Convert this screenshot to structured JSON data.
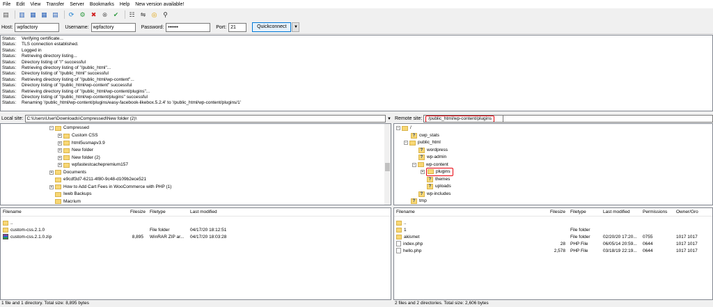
{
  "menu": [
    "File",
    "Edit",
    "View",
    "Transfer",
    "Server",
    "Bookmarks",
    "Help",
    "New version available!"
  ],
  "toolbar_icons": [
    "site-manager-icon",
    "toggle-log-icon",
    "toggle-local-tree-icon",
    "toggle-remote-tree-icon",
    "refresh-icon",
    "process-queue-icon",
    "cancel-icon",
    "disconnect-icon",
    "reconnect-icon",
    "filter-icon",
    "compare-icon",
    "sync-browse-icon",
    "search-icon"
  ],
  "quickconnect": {
    "host_label": "Host:",
    "host_value": "wpfactory",
    "user_label": "Username:",
    "user_value": "wpfactory",
    "pass_label": "Password:",
    "pass_value": "••••••",
    "port_label": "Port:",
    "port_value": "21",
    "button": "Quickconnect"
  },
  "log": [
    {
      "label": "Status:",
      "text": "Verifying certificate..."
    },
    {
      "label": "Status:",
      "text": "TLS connection established."
    },
    {
      "label": "Status:",
      "text": "Logged in"
    },
    {
      "label": "Status:",
      "text": "Retrieving directory listing..."
    },
    {
      "label": "Status:",
      "text": "Directory listing of \"/\" successful"
    },
    {
      "label": "Status:",
      "text": "Retrieving directory listing of \"/public_html\"..."
    },
    {
      "label": "Status:",
      "text": "Directory listing of \"/public_html\" successful"
    },
    {
      "label": "Status:",
      "text": "Retrieving directory listing of \"/public_html/wp-content\"..."
    },
    {
      "label": "Status:",
      "text": "Directory listing of \"/public_html/wp-content\" successful"
    },
    {
      "label": "Status:",
      "text": "Retrieving directory listing of \"/public_html/wp-content/plugins\"..."
    },
    {
      "label": "Status:",
      "text": "Directory listing of \"/public_html/wp-content/plugins\" successful"
    },
    {
      "label": "Status:",
      "text": "Renaming '/public_html/wp-content/plugins/easy-facebook-likebox.5.2.4' to '/public_html/wp-content/plugins/1'"
    }
  ],
  "local": {
    "site_label": "Local site:",
    "path": "C:\\Users\\User\\Downloads\\Compressed\\New folder (2)\\",
    "tree": [
      "Compressed",
      "Custom CSS",
      "html5usmapv3.9",
      "New folder",
      "New folder (2)",
      "wpfastestcachepremium157",
      "Documents",
      "e9cdf3d7-6211-4f80-9c48-d109b2ece521",
      "How to Add Cart Fees in WooCommerce with PHP (1)",
      "Iweb Backups",
      "Macrium"
    ],
    "columns": [
      "Filename",
      "Filesize",
      "Filetype",
      "Last modified"
    ],
    "files": [
      {
        "name": "..",
        "size": "",
        "type": "",
        "modified": ""
      },
      {
        "name": "custom-css.2.1.0",
        "size": "",
        "type": "File folder",
        "modified": "04/17/20 18:12:51"
      },
      {
        "name": "custom-css.2.1.0.zip",
        "size": "8,895",
        "type": "WinRAR ZIP ar...",
        "modified": "04/17/20 18:03:28"
      }
    ],
    "status": "1 file and 1 directory. Total size: 8,895 bytes"
  },
  "remote": {
    "site_label": "Remote site:",
    "path": "/public_html/wp-content/plugins",
    "tree": [
      "/",
      "cwp_stats",
      "public_html",
      "wordpress",
      "wp-admin",
      "wp-content",
      "plugins",
      "themes",
      "uploads",
      "wp-includes",
      "tmp"
    ],
    "columns": [
      "Filename",
      "Filesize",
      "Filetype",
      "Last modified",
      "Permissions",
      "Owner/Gro"
    ],
    "files": [
      {
        "name": "..",
        "size": "",
        "type": "",
        "modified": "",
        "perm": "",
        "owner": ""
      },
      {
        "name": "1",
        "size": "",
        "type": "File folder",
        "modified": "",
        "perm": "",
        "owner": ""
      },
      {
        "name": "akismet",
        "size": "",
        "type": "File folder",
        "modified": "02/20/20 17:20...",
        "perm": "0755",
        "owner": "1017 1017"
      },
      {
        "name": "index.php",
        "size": "28",
        "type": "PHP File",
        "modified": "06/05/14 20:59...",
        "perm": "0644",
        "owner": "1017 1017"
      },
      {
        "name": "hello.php",
        "size": "2,578",
        "type": "PHP File",
        "modified": "03/18/19 22:19...",
        "perm": "0644",
        "owner": "1017 1017"
      }
    ],
    "status": "2 files and 2 directories. Total size: 2,606 bytes"
  }
}
